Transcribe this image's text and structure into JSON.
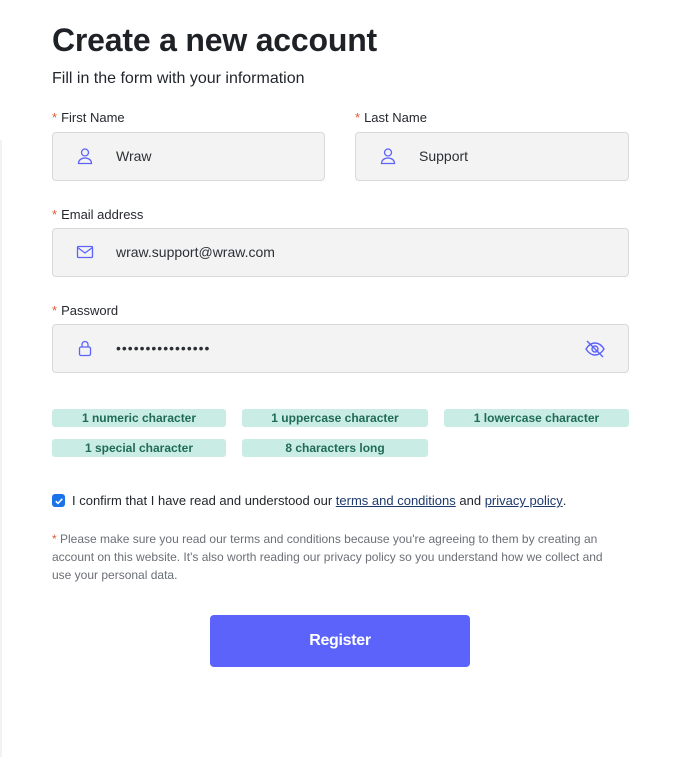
{
  "header": {
    "title": "Create a new account",
    "subtitle": "Fill in the form with your information"
  },
  "form": {
    "first_name": {
      "label": "First Name",
      "value": "Wraw",
      "icon": "user-icon"
    },
    "last_name": {
      "label": "Last Name",
      "value": "Support",
      "icon": "user-icon"
    },
    "email": {
      "label": "Email address",
      "value": "wraw.support@wraw.com",
      "icon": "mail-icon"
    },
    "password": {
      "label": "Password",
      "value": "••••••••••••••••",
      "icon": "lock-icon",
      "toggle_icon": "eye-off-icon"
    },
    "required_mark": "*"
  },
  "password_rules": [
    {
      "label": "1 numeric character"
    },
    {
      "label": "1 uppercase character"
    },
    {
      "label": "1 lowercase character"
    },
    {
      "label": "1 special character"
    },
    {
      "label": "8 characters long"
    }
  ],
  "consent": {
    "checked": true,
    "text_before": "I confirm that I have read and understood our",
    "terms_link": "terms and conditions",
    "text_and": "and",
    "privacy_link": "privacy policy",
    "text_end": "."
  },
  "note": {
    "star": "*",
    "text": "Please make sure you read our terms and conditions because you're agreeing to them by creating an account on this website. It's also worth reading our privacy policy so you understand how we collect and use your personal data."
  },
  "actions": {
    "register_label": "Register"
  },
  "colors": {
    "accent": "#5b63fb",
    "icon": "#5b63fb",
    "chip_bg": "#c9ede5",
    "chip_text": "#1f6b54",
    "required": "#e0592f"
  }
}
